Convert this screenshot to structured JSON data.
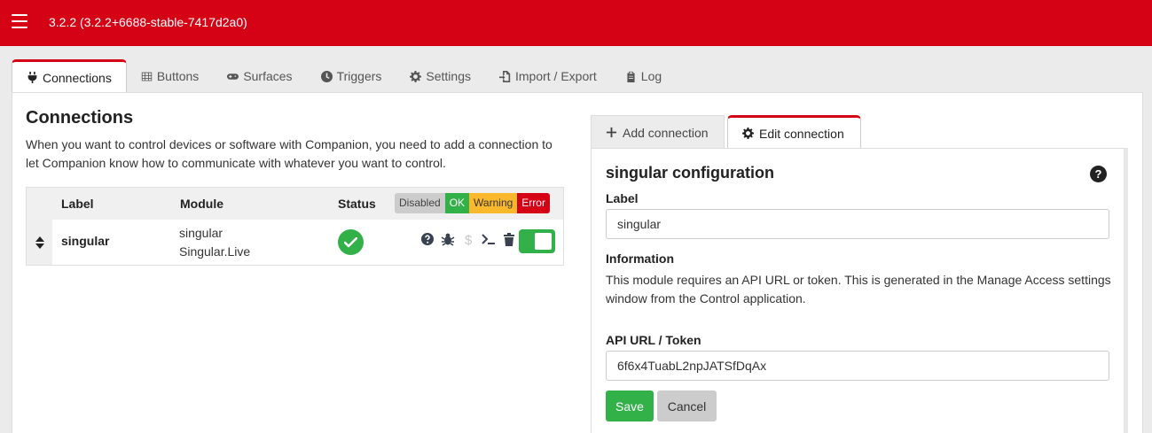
{
  "header": {
    "version": "3.2.2 (3.2.2+6688-stable-7417d2a0)",
    "menu_icon": "hamburger-icon"
  },
  "tabs": [
    {
      "label": "Connections",
      "icon": "plug-icon",
      "active": true
    },
    {
      "label": "Buttons",
      "icon": "grid-icon"
    },
    {
      "label": "Surfaces",
      "icon": "gamepad-icon"
    },
    {
      "label": "Triggers",
      "icon": "clock-icon"
    },
    {
      "label": "Settings",
      "icon": "gear-icon"
    },
    {
      "label": "Import / Export",
      "icon": "file-import-icon"
    },
    {
      "label": "Log",
      "icon": "clipboard-icon"
    }
  ],
  "connections": {
    "title": "Connections",
    "description": "When you want to control devices or software with Companion, you need to add a connection to let Companion know how to communicate with whatever you want to control.",
    "columns": {
      "label": "Label",
      "module": "Module",
      "status": "Status"
    },
    "legend": {
      "disabled": "Disabled",
      "ok": "OK",
      "warning": "Warning",
      "error": "Error"
    },
    "rows": [
      {
        "label": "singular",
        "module_name": "singular",
        "module_product": "Singular.Live",
        "status": "ok",
        "enabled": true
      }
    ]
  },
  "right_tabs": {
    "add": "Add connection",
    "edit": "Edit connection"
  },
  "editor": {
    "title": "singular configuration",
    "label_heading": "Label",
    "label_value": "singular",
    "info_heading": "Information",
    "info_text": "This module requires an API URL or token. This is generated in the Manage Access settings window from the Control application.",
    "token_heading": "API URL / Token",
    "token_value": "6f6x4TuabL2npJATSfDqAx",
    "save_label": "Save",
    "cancel_label": "Cancel"
  },
  "colors": {
    "brand_red": "#d50215",
    "ok_green": "#33b149",
    "warning_yellow": "#fab92c",
    "disabled_grey": "#cccccc"
  }
}
